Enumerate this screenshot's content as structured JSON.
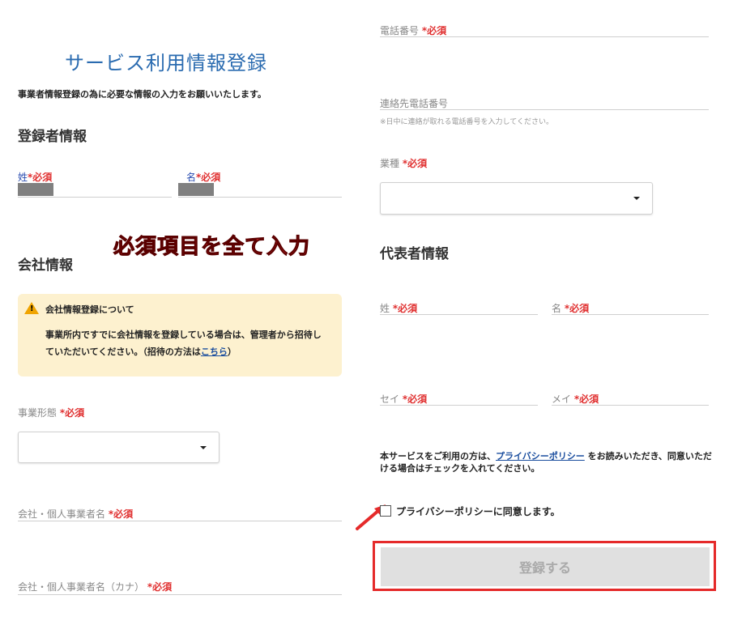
{
  "page": {
    "title": "サービス利用情報登録",
    "subtitle": "事業者情報登録の為に必要な情報の入力をお願いいたします。"
  },
  "required_mark": "*必須",
  "registrant": {
    "heading": "登録者情報",
    "last_name_label": "姓",
    "first_name_label": "名"
  },
  "overlay_text": "必須項目を全て入力",
  "company": {
    "heading": "会社情報",
    "notice": {
      "title": "会社情報登録について",
      "body": "事業所内ですでに会社情報を登録している場合は、管理者から招待していただいてください。（招待の方法は",
      "link": "こちら",
      "body_end": "）"
    },
    "business_type_label": "事業形態",
    "company_name_label": "会社・個人事業者名",
    "company_name_kana_label": "会社・個人事業者名（カナ）"
  },
  "right": {
    "phone_label": "電話番号",
    "contact_phone_label": "連絡先電話番号",
    "contact_phone_hint": "※日中に連絡が取れる電話番号を入力してください。",
    "industry_label": "業種"
  },
  "representative": {
    "heading": "代表者情報",
    "last_name_label": "姓",
    "first_name_label": "名",
    "last_name_kana_label": "セイ",
    "first_name_kana_label": "メイ"
  },
  "privacy": {
    "text_before": "本サービスをご利用の方は、",
    "link": "プライバシーポリシー",
    "text_after": "をお読みいただき、同意いただける場合はチェックを入れてください。",
    "checkbox_label": "プライバシーポリシーに同意します。",
    "checked": false
  },
  "submit_label": "登録する",
  "colors": {
    "title": "#2a6bb0",
    "required": "#e03030",
    "annotation_red": "#e52a2a",
    "notice_bg": "#fdf1cf",
    "link": "#1a4d9e"
  }
}
